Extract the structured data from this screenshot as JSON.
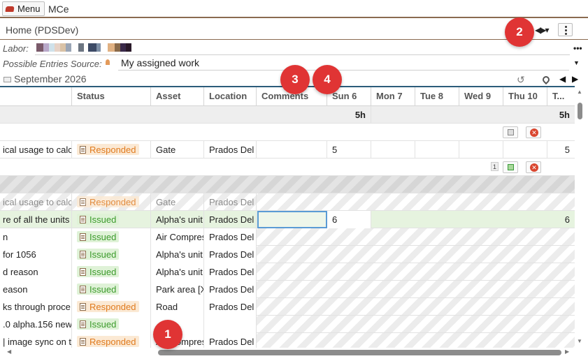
{
  "topbar": {
    "menu_label": "Menu",
    "app_name": "MCe"
  },
  "header": {
    "title": "Home (PDSDev)",
    "nav_arrows": "◀▶▾"
  },
  "labor": {
    "label": "Labor:",
    "blocks": [
      "#7a5a6a",
      "#b9a9c9",
      "#cfe1ea",
      "#e6d2c6",
      "#d9c2a6",
      "#9aa5b5",
      "#ffffff",
      "#6d7682",
      "#ffffff",
      "#3d4b66",
      "#7d8fa6",
      "#ffffff",
      "#e0b183",
      "#8a6a4a",
      "#3a2a4a",
      "#2a1a2a"
    ]
  },
  "source": {
    "label": "Possible Entries Source:",
    "value": "My assigned work"
  },
  "month": {
    "label": "September 2026"
  },
  "columns": {
    "status": "Status",
    "asset": "Asset",
    "location": "Location",
    "comments": "Comments",
    "sun6": "Sun 6",
    "mon7": "Mon 7",
    "tue8": "Tue 8",
    "wed9": "Wed 9",
    "thu10": "Thu 10",
    "more": "T..."
  },
  "totals": {
    "sun6": "5h",
    "last": "5h"
  },
  "rows": [
    {
      "desc": "ical usage to calc",
      "status": "Responded",
      "asset": "Gate",
      "location": "Prados Del",
      "sun6": "5",
      "last": "5"
    },
    {
      "desc": "ical usage to calc",
      "status": "Responded",
      "asset": "Gate",
      "location": "Prados Del"
    },
    {
      "desc": "re of all the units",
      "status": "Issued",
      "asset": "Alpha's unit",
      "location": "Prados Del",
      "sun6": "6",
      "last": "6"
    },
    {
      "desc": "n",
      "status": "Issued",
      "asset": "Air Compres",
      "location": "Prados Del"
    },
    {
      "desc": " for 1056",
      "status": "Issued",
      "asset": "Alpha's unit",
      "location": "Prados Del"
    },
    {
      "desc": "d reason",
      "status": "Issued",
      "asset": "Alpha's unit",
      "location": "Prados Del"
    },
    {
      "desc": "eason",
      "status": "Issued",
      "asset": "Park area [X",
      "location": "Prados Del"
    },
    {
      "desc": "ks through proce",
      "status": "Responded",
      "asset": "Road",
      "location": "Prados Del"
    },
    {
      "desc": ".0 alpha.156 new",
      "status": "Issued",
      "asset": "",
      "location": ""
    },
    {
      "desc": "| image sync on t",
      "status": "Responded",
      "asset": "Air Compres",
      "location": "Prados Del"
    }
  ],
  "pending_count": "1",
  "markers": {
    "m1": "1",
    "m2": "2",
    "m3": "3",
    "m4": "4"
  },
  "colors": {
    "responded": "#e07b1f",
    "issued": "#3c9b2c",
    "accent": "#2c5c7a",
    "marker": "#e03434"
  },
  "icons": [
    "menu-logo-icon",
    "nav-arrows-icon",
    "more-vertical-icon",
    "calendar-icon",
    "refresh-icon",
    "location-pin-icon",
    "prev-arrow-icon",
    "next-arrow-icon",
    "document-icon",
    "save-icon",
    "cancel-icon"
  ]
}
